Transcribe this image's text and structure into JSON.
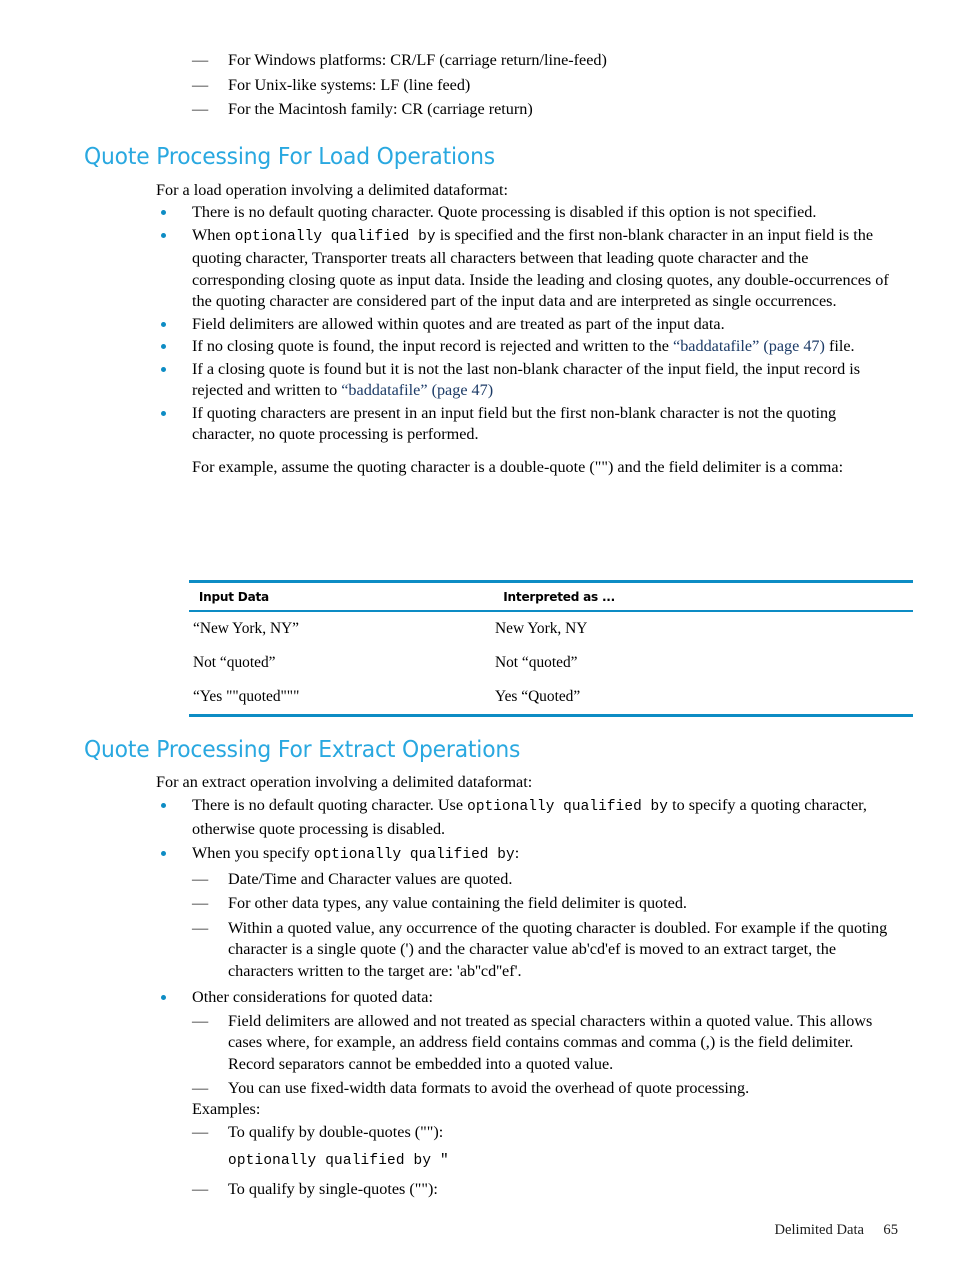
{
  "document": {
    "footer_section": "Delimited Data",
    "footer_page": "65"
  },
  "colors": {
    "heading_blue": "#29a8e0",
    "rule_blue": "#0d8cc4",
    "bullet_blue": "#0d8cc4",
    "xref_blue": "#1b3a66"
  },
  "intro_list": {
    "items": [
      "For Windows platforms: CR/LF (carriage return/line-feed)",
      "For Unix-like systems: LF (line feed)",
      "For the Macintosh family: CR (carriage return)"
    ]
  },
  "load_section": {
    "heading": "Quote Processing For Load Operations",
    "intro": "For a load operation involving a delimited dataformat:",
    "bullets": {
      "b1": "There is no default quoting character. Quote processing is disabled if this option is not specified.",
      "b2_lead": "When ",
      "b2_code": "optionally qualified by",
      "b2_tail": " is specified and the first non-blank character in an input field is the quoting character, Transporter treats all characters between that leading quote character and the corresponding closing quote as input data. Inside the leading and closing quotes, any double-occurrences of the quoting character are considered part of the input data and are interpreted as single occurrences.",
      "b3": "Field delimiters are allowed within quotes and are treated as part of the input data.",
      "b4_lead": "If no closing quote is found, the input record is rejected and written to the ",
      "b4_link1": "“baddatafile”",
      "b4_link2": "(page 47)",
      "b4_tail": " file.",
      "b5_lead": "If a closing quote is found but it is not the last non-blank character of the input field, the input record is rejected and written to ",
      "b5_link1": "“baddatafile”",
      "b5_link2": "(page 47)",
      "b6": "If quoting characters are present in an input field but the first non-blank character is not the quoting character, no quote processing is performed.",
      "b6_note": "For example, assume the quoting character is a double-quote (\"\") and the field delimiter is a comma:"
    }
  },
  "example_table": {
    "headers": [
      "Input Data",
      "Interpreted as ..."
    ],
    "rows": [
      [
        "“New York, NY”",
        "New York, NY"
      ],
      [
        "Not “quoted”",
        "Not “quoted”"
      ],
      [
        "“Yes \"\"quoted\"\"\"",
        "Yes “Quoted”"
      ]
    ]
  },
  "extract_section": {
    "heading": "Quote Processing For Extract Operations",
    "intro": "For an extract operation involving a delimited dataformat:",
    "bullets": {
      "b1_lead": "There is no default quoting character. Use ",
      "b1_code": "optionally qualified by",
      "b1_tail": " to specify a quoting character, otherwise quote processing is disabled.",
      "b2_lead": "When you specify ",
      "b2_code": "optionally qualified by",
      "b2_tail": ":",
      "b2_subitems": [
        "Date/Time and Character values are quoted.",
        "For other data types, any value containing the field delimiter is quoted.",
        "Within a quoted value, any occurrence of the quoting character is doubled. For example if the quoting character is a single quote (') and the character value ab'cd'ef is moved to an extract target, the characters written to the target are: 'ab''cd''ef'."
      ],
      "b3": "Other considerations for quoted data:",
      "b3_subitems": [
        "Field delimiters are allowed and not treated as special characters within a quoted value. This allows cases where, for example, an address field contains commas and comma (,) is the field delimiter. Record separators cannot be embedded into a quoted value.",
        "You can use fixed-width data formats to avoid the overhead of quote processing."
      ]
    },
    "examples_label": "Examples:",
    "examples": [
      {
        "label": "To qualify by double-quotes (\"\"):",
        "code": "optionally qualified by \""
      },
      {
        "label": "To qualify by single-quotes (\"\"):",
        "code": ""
      }
    ]
  }
}
